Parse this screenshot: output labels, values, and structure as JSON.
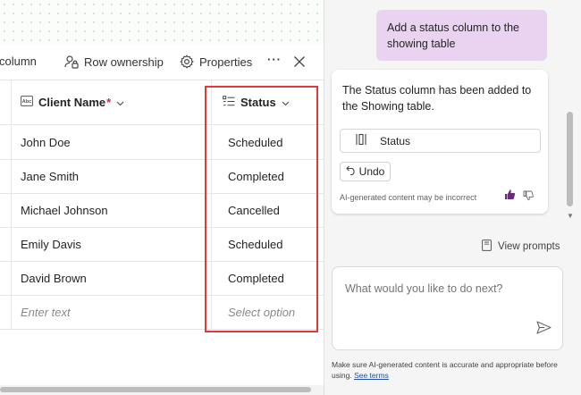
{
  "toolbar": {
    "add_column_label": "column",
    "row_ownership_label": "Row ownership",
    "properties_label": "Properties",
    "more_label": "···"
  },
  "table": {
    "columns": {
      "client_name": "Client Name",
      "required_mark": "*",
      "status": "Status"
    },
    "rows": [
      {
        "client_name": "John Doe",
        "status": "Scheduled"
      },
      {
        "client_name": "Jane Smith",
        "status": "Completed"
      },
      {
        "client_name": "Michael Johnson",
        "status": "Cancelled"
      },
      {
        "client_name": "Emily Davis",
        "status": "Scheduled"
      },
      {
        "client_name": "David Brown",
        "status": "Completed"
      }
    ],
    "new_row": {
      "client_name_placeholder": "Enter text",
      "status_placeholder": "Select option"
    }
  },
  "copilot": {
    "user_message": "Add a status column to the showing table",
    "ai_message": "The Status column has been added to the Showing table.",
    "status_chip_label": "Status",
    "undo_label": "Undo",
    "disclaimer": "AI-generated content may be incorrect",
    "view_prompts_label": "View prompts",
    "composer_placeholder": "What would you like to do next?",
    "footer_text": "Make sure AI-generated content is accurate and appropriate before using.",
    "footer_link": "See terms"
  },
  "colors": {
    "highlight_border": "#e0383b",
    "user_bubble": "#ead3f1",
    "thumb_up_active": "#6b2c7a",
    "link": "#1f4fa8"
  },
  "icons": {
    "row_ownership": "person-lock-icon",
    "properties": "gear-icon",
    "close": "close-icon",
    "text_column": "text-abc-icon",
    "choice_column": "list-choice-icon",
    "undo": "undo-arrow-icon",
    "view_prompts": "notebook-icon",
    "send": "send-icon"
  }
}
